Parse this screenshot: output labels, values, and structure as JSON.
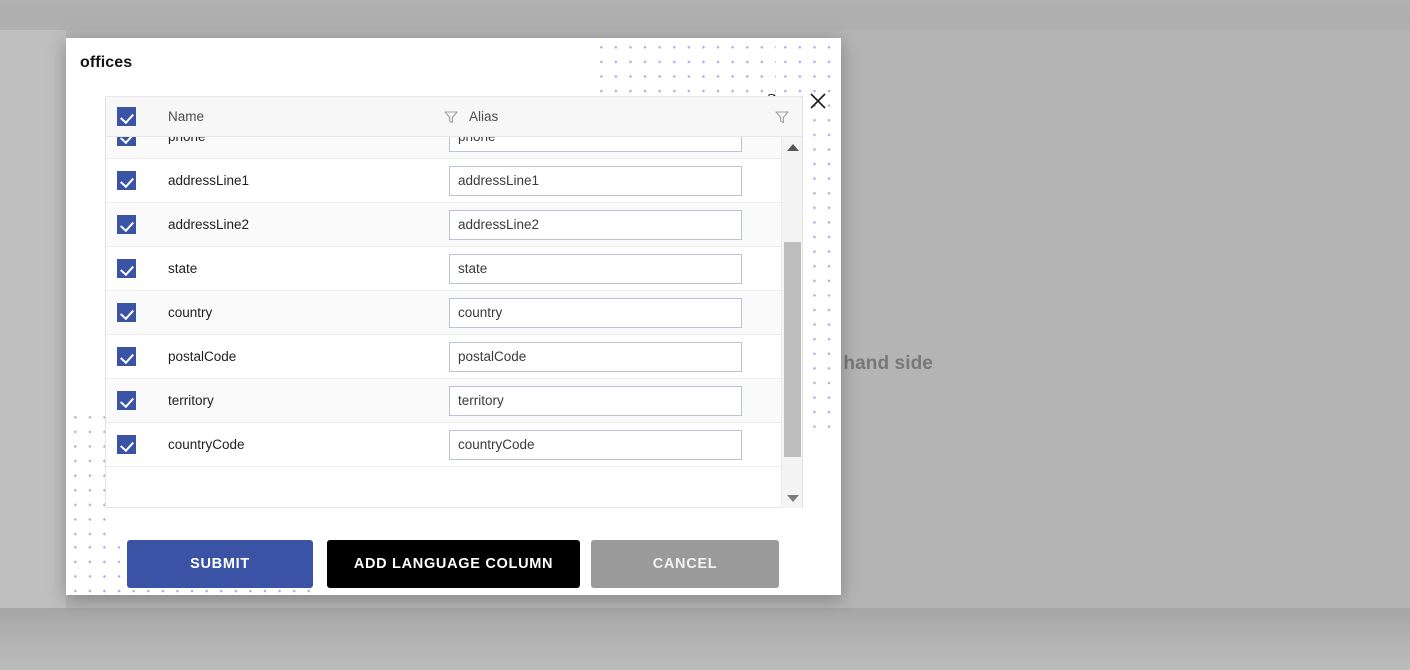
{
  "backdrop": {
    "visible_text": "n left hand side",
    "overlay_color": "#b4b4b4"
  },
  "dialog": {
    "title": "offices",
    "help_icon": "question-mark-icon",
    "close_icon": "close-icon",
    "accent_color": "#3a53a4"
  },
  "grid": {
    "columns": [
      {
        "key": "name",
        "label": "Name",
        "filter_icon": "filter-funnel-icon"
      },
      {
        "key": "alias",
        "label": "Alias",
        "filter_icon": "filter-funnel-icon"
      }
    ],
    "select_all_checked": true,
    "rows": [
      {
        "checked": true,
        "name": "phone",
        "alias": "phone"
      },
      {
        "checked": true,
        "name": "addressLine1",
        "alias": "addressLine1"
      },
      {
        "checked": true,
        "name": "addressLine2",
        "alias": "addressLine2"
      },
      {
        "checked": true,
        "name": "state",
        "alias": "state"
      },
      {
        "checked": true,
        "name": "country",
        "alias": "country"
      },
      {
        "checked": true,
        "name": "postalCode",
        "alias": "postalCode"
      },
      {
        "checked": true,
        "name": "territory",
        "alias": "territory"
      },
      {
        "checked": true,
        "name": "countryCode",
        "alias": "countryCode"
      }
    ],
    "scrollbar": {
      "up_arrow_icon": "triangle-up-icon",
      "down_arrow_icon": "triangle-down-icon"
    }
  },
  "footer": {
    "submit_label": "SUBMIT",
    "add_language_label": "ADD LANGUAGE COLUMN",
    "cancel_label": "CANCEL"
  }
}
